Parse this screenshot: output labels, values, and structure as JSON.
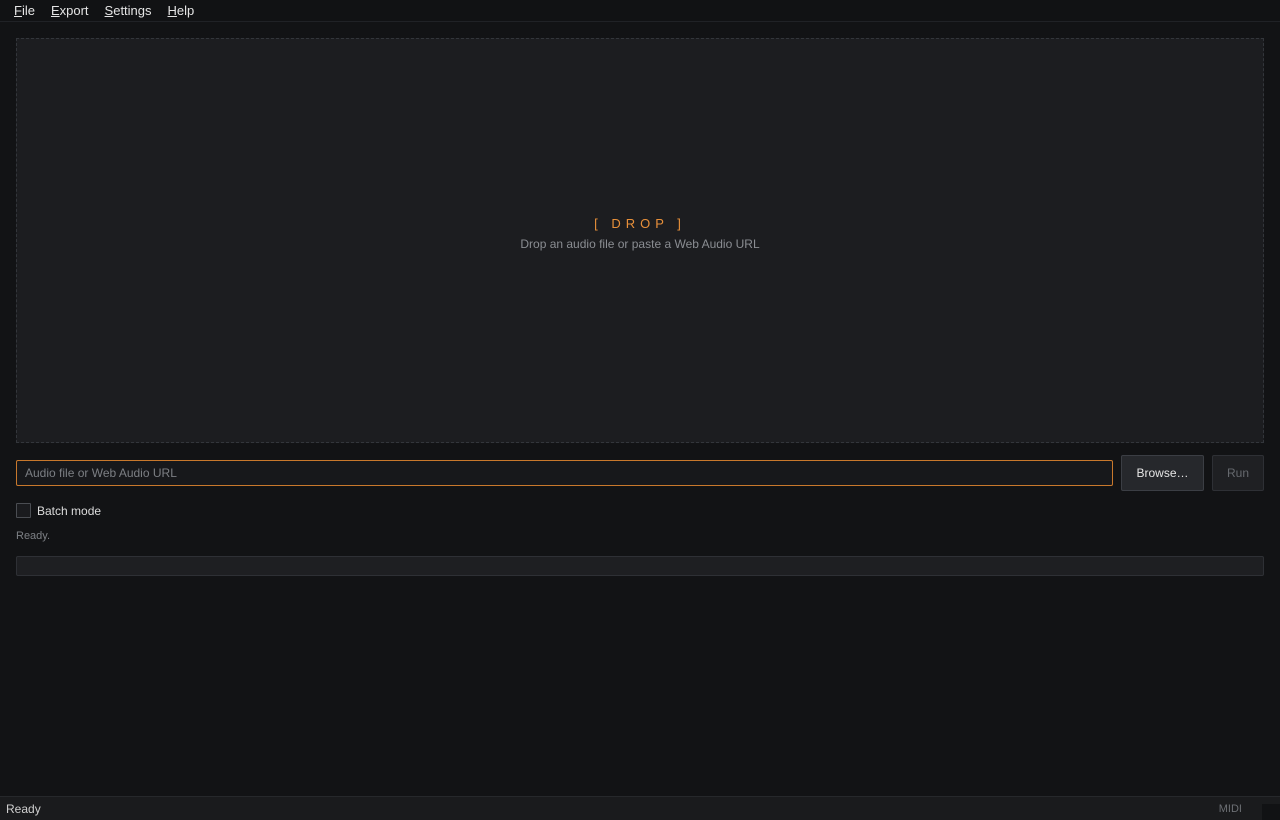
{
  "menu": {
    "items": [
      {
        "mnemonic": "F",
        "rest": "ile"
      },
      {
        "mnemonic": "E",
        "rest": "xport"
      },
      {
        "mnemonic": "S",
        "rest": "ettings"
      },
      {
        "mnemonic": "H",
        "rest": "elp"
      }
    ]
  },
  "dropzone": {
    "title": "[ DROP ]",
    "hint": "Drop an audio file or paste a Web Audio URL"
  },
  "source": {
    "value": "",
    "placeholder": "Audio file or Web Audio URL"
  },
  "buttons": {
    "browse": "Browse…",
    "run": "Run"
  },
  "batch": {
    "label": "Batch mode",
    "checked": false
  },
  "status_line": "Ready.",
  "progress": {
    "percent": 0
  },
  "statusbar": {
    "left": "Ready",
    "right": "MIDI"
  },
  "colors": {
    "accent": "#e8903a",
    "background": "#121315"
  }
}
